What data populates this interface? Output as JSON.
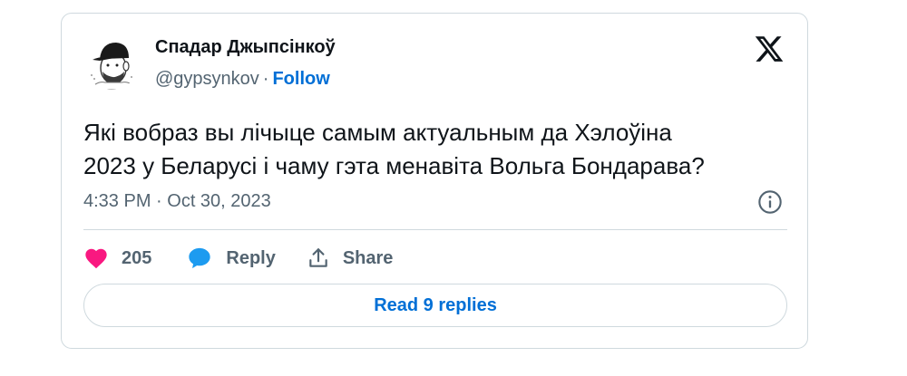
{
  "author": {
    "display_name": "Спадар Джыпсінкоў",
    "handle": "@gypsynkov",
    "separator": "·",
    "follow_label": "Follow"
  },
  "tweet": {
    "text_line1": "Які вобраз вы лічыце самым актуальным да Хэлоўіна",
    "text_line2": "2023 у Беларусі і чаму гэта менавіта Вольга Бондарава?",
    "timestamp": "4:33 PM · Oct 30, 2023"
  },
  "actions": {
    "like_count": "205",
    "reply_label": "Reply",
    "share_label": "Share"
  },
  "read_replies_label": "Read 9 replies",
  "colors": {
    "text": "#0f1419",
    "secondary": "#536471",
    "link": "#006fd6",
    "like": "#f91880",
    "reply": "#1d9bf0",
    "border": "#cfd9de"
  },
  "icons": [
    "avatar-cartoon",
    "x-logo-icon",
    "info-icon",
    "heart-icon",
    "reply-bubble-icon",
    "share-icon"
  ]
}
